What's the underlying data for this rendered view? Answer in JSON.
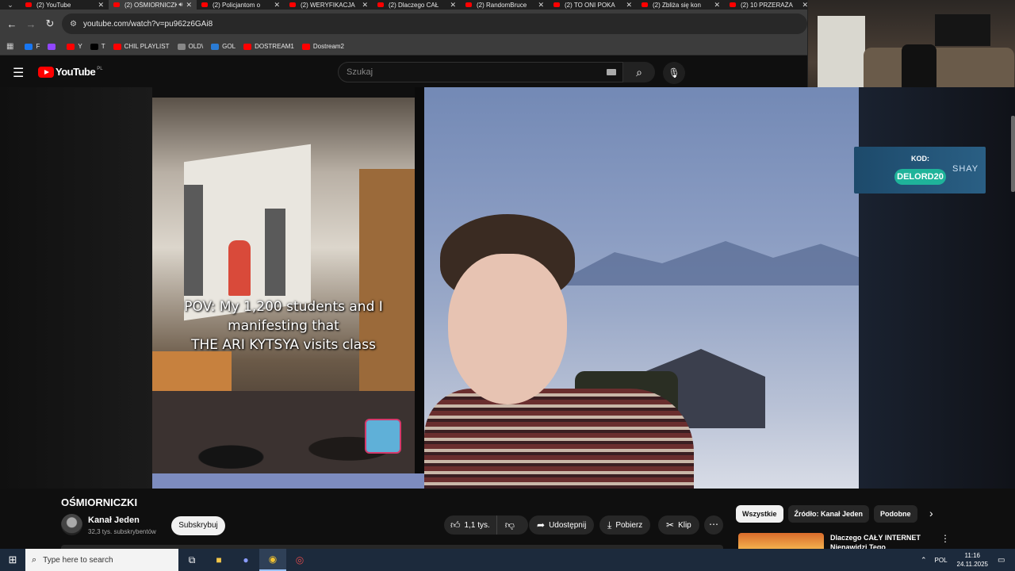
{
  "browser": {
    "tabs": [
      {
        "title": "(2) YouTube",
        "active": false
      },
      {
        "title": "(2) OŚMIORNICZKI",
        "active": true,
        "audio": true
      },
      {
        "title": "(2) Policjantom o",
        "active": false
      },
      {
        "title": "(2) WERYFIKACJA",
        "active": false
      },
      {
        "title": "(2) Dlaczego CAŁ",
        "active": false
      },
      {
        "title": "(2) RandomBruce",
        "active": false
      },
      {
        "title": "(2) TO ONI POKA",
        "active": false
      },
      {
        "title": "(2) Zbliża się kon",
        "active": false
      },
      {
        "title": "(2) 10 PRZERAŻA",
        "active": false
      }
    ],
    "tab_close_glyph": "✕",
    "url": "youtube.com/watch?v=pu962z6GAi8",
    "bookmarks": [
      {
        "label": "F",
        "color": "#1877f2"
      },
      {
        "label": "",
        "color": "#9146ff"
      },
      {
        "label": "Y",
        "color": "#ff0000"
      },
      {
        "label": "T",
        "color": "#000000"
      },
      {
        "label": "CHIL PLAYLIST",
        "color": "#ff0000"
      },
      {
        "label": "OLD\\",
        "color": "#888888"
      },
      {
        "label": "GOL",
        "color": "#2a7bd4"
      },
      {
        "label": "DOSTREAM1",
        "color": "#ff0000"
      },
      {
        "label": "Dostream2",
        "color": "#ff0000"
      }
    ]
  },
  "youtube": {
    "logo_text": "YouTube",
    "logo_region": "PL",
    "search_placeholder": "Szukaj",
    "video": {
      "caption_lines": [
        "POV: My 1,200 students and I",
        "manifesting that",
        "THE ARI KYTSYA  visits class"
      ],
      "promo_label": "KOD:",
      "promo_code": "DELORD20",
      "promo_brand": "SHAY"
    },
    "title": "OŚMIORNICZKI",
    "channel": {
      "name": "Kanał Jeden",
      "subscribers": "32,3 tys. subskrybentów",
      "subscribe_label": "Subskrybuj"
    },
    "actions": {
      "likes": "1,1 tys.",
      "share": "Udostępnij",
      "download": "Pobierz",
      "clip": "Klip"
    },
    "chips": [
      "Wszystkie",
      "Źródło: Kanał Jeden",
      "Podobne"
    ],
    "recommendation": {
      "title": "Dlaczego CAŁY INTERNET Nienawidzi Tego STREAMERA?"
    }
  },
  "taskbar": {
    "search_placeholder": "Type here to search",
    "language": "POL",
    "time": "11:16",
    "date": "24.11.2025"
  },
  "colors": {
    "accent": "#ff0000",
    "background": "#0f0f0f",
    "taskbar": "#1c2a3c"
  }
}
